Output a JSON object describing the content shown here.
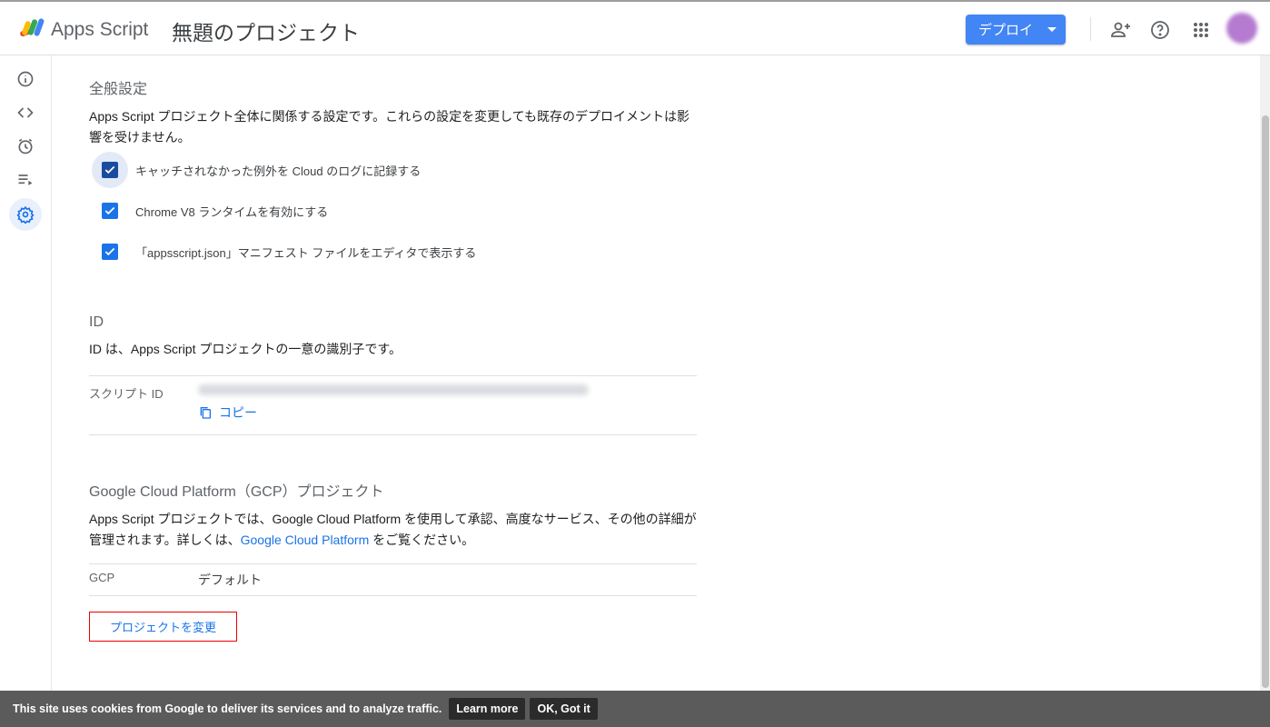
{
  "header": {
    "app_name": "Apps Script",
    "project_title": "無題のプロジェクト",
    "deploy_label": "デプロイ",
    "icons": [
      "add-person-icon",
      "help-icon",
      "apps-grid-icon"
    ]
  },
  "rail": {
    "items": [
      "info-icon",
      "code-icon",
      "clock-icon",
      "executions-icon",
      "settings-icon"
    ],
    "active": "settings-icon"
  },
  "general": {
    "title": "全般設定",
    "description": "Apps Script プロジェクト全体に関係する設定です。これらの設定を変更しても既存のデプロイメントは影響を受けません。",
    "checkboxes": [
      {
        "label": "キャッチされなかった例外を Cloud のログに記録する",
        "checked": true
      },
      {
        "label": "Chrome V8 ランタイムを有効にする",
        "checked": true
      },
      {
        "label": "「appsscript.json」マニフェスト ファイルをエディタで表示する",
        "checked": true
      }
    ]
  },
  "id_section": {
    "title": "ID",
    "description": "ID は、Apps Script プロジェクトの一意の識別子です。",
    "script_id_label": "スクリプト ID",
    "copy_label": "コピー"
  },
  "gcp": {
    "title": "Google Cloud Platform（GCP）プロジェクト",
    "desc_part1": "Apps Script プロジェクトでは、Google Cloud Platform を使用して承認、高度なサービス、その他の詳細が管理されます。詳しくは、",
    "desc_link": "Google Cloud Platform",
    "desc_part2": " をご覧ください。",
    "gcp_label": "GCP",
    "gcp_value": "デフォルト",
    "change_label": "プロジェクトを変更"
  },
  "cookie": {
    "message": "This site uses cookies from Google to deliver its services and to analyze traffic.",
    "learn_more": "Learn more",
    "ok": "OK, Got it"
  },
  "colors": {
    "accent": "#1a73e8",
    "deploy": "#4285f4",
    "highlight_border": "#ee0000"
  }
}
